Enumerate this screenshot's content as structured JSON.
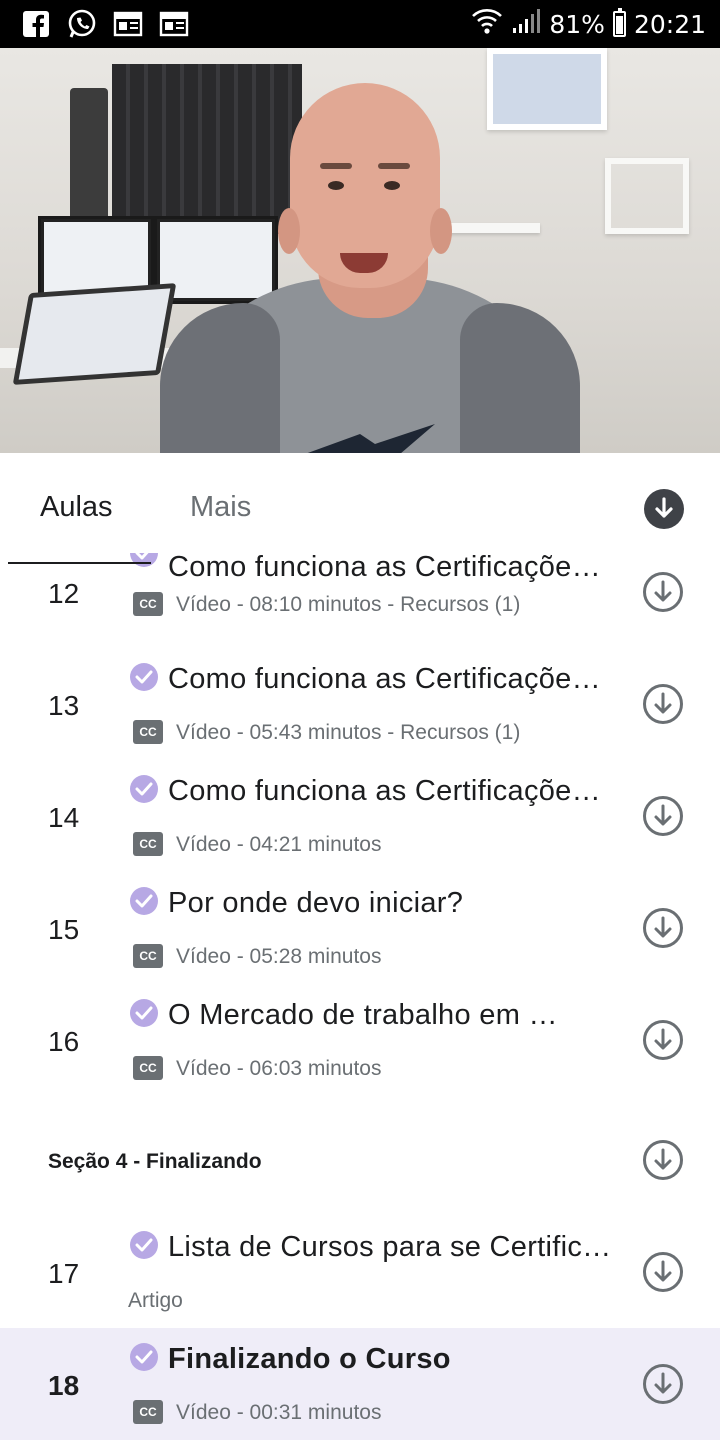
{
  "status_bar": {
    "battery": "81%",
    "time": "20:21",
    "notification_icons": [
      "facebook-icon",
      "whatsapp-icon",
      "newspaper-icon",
      "newspaper-icon"
    ]
  },
  "tabs": [
    {
      "label": "Aulas",
      "active": true
    },
    {
      "label": "Mais",
      "active": false
    }
  ],
  "lectures_before_section": [
    {
      "number": "12",
      "title": "Como funciona as Certificações…",
      "meta": "Vídeo - 08:10 minutos - Recursos (1)",
      "type": "video"
    },
    {
      "number": "13",
      "title": "Como funciona as Certificações…",
      "meta": "Vídeo - 05:43 minutos - Recursos (1)",
      "type": "video"
    },
    {
      "number": "14",
      "title": "Como funciona as Certificações…",
      "meta": "Vídeo - 04:21 minutos",
      "type": "video"
    },
    {
      "number": "15",
      "title": "Por onde devo iniciar?",
      "meta": "Vídeo - 05:28 minutos",
      "type": "video"
    },
    {
      "number": "16",
      "title": "O Mercado de trabalho em …",
      "meta": "Vídeo - 06:03 minutos",
      "type": "video"
    }
  ],
  "section": {
    "title": "Seção 4 - Finalizando"
  },
  "lectures_after_section": [
    {
      "number": "17",
      "title": "Lista de Cursos para se Certificar…",
      "meta": "Artigo",
      "type": "article"
    },
    {
      "number": "18",
      "title": "Finalizando o Curso",
      "meta": "Vídeo - 00:31 minutos",
      "type": "video",
      "selected": true
    }
  ],
  "cc_label": "CC",
  "colors": {
    "check": "#b7a8e4",
    "selected_row": "#efedf8",
    "muted_text": "#6a6f73",
    "primary_text": "#1c1d1f"
  }
}
